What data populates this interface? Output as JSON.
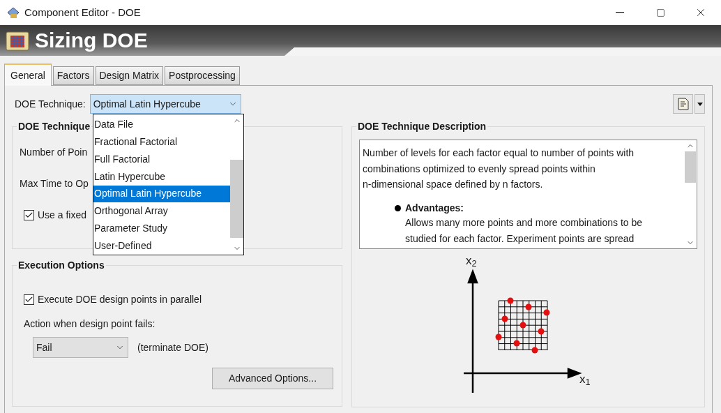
{
  "window": {
    "title": "Component Editor - DOE"
  },
  "banner": {
    "title": "Sizing DOE"
  },
  "tabs": [
    {
      "label": "General",
      "selected": true
    },
    {
      "label": "Factors",
      "selected": false
    },
    {
      "label": "Design Matrix",
      "selected": false
    },
    {
      "label": "Postprocessing",
      "selected": false
    }
  ],
  "technique": {
    "label": "DOE Technique:",
    "value": "Optimal Latin Hypercube",
    "options": [
      {
        "label": "Data File",
        "selected": false
      },
      {
        "label": "Fractional Factorial",
        "selected": false
      },
      {
        "label": "Full Factorial",
        "selected": false
      },
      {
        "label": "Latin Hypercube",
        "selected": false
      },
      {
        "label": "Optimal Latin Hypercube",
        "selected": true
      },
      {
        "label": "Orthogonal Array",
        "selected": false
      },
      {
        "label": "Parameter Study",
        "selected": false
      },
      {
        "label": "User-Defined",
        "selected": false
      }
    ]
  },
  "technique_group": {
    "title": "DOE Technique",
    "fields": [
      {
        "label": "Number of Poin"
      },
      {
        "label": "Max Time to Op"
      }
    ],
    "checkbox": {
      "label": "Use a fixed",
      "checked": true
    }
  },
  "execution": {
    "title": "Execution Options",
    "parallel": {
      "label": "Execute DOE design points in parallel",
      "checked": true
    },
    "fail_label": "Action when design point fails:",
    "fail_value": "Fail",
    "fail_note": "(terminate DOE)",
    "advanced_button": "Advanced Options..."
  },
  "description": {
    "title": "DOE Technique Description",
    "text": "Number of levels for each factor equal to number of points with\ncombinations optimized to evenly spread points within\nn-dimensional space defined by n factors.",
    "bullet_title": "Advantages:",
    "bullet_text": "Allows many more points and more combinations to be\nstudied for each factor. Experiment points are spread"
  },
  "diagram": {
    "x_label": "x$_{1}$",
    "y_label": "x$_{2}$"
  }
}
